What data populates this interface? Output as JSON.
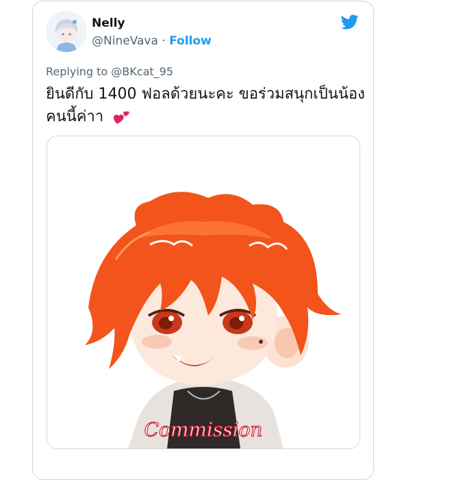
{
  "tweet": {
    "author_name": "Nelly",
    "author_handle": "@NineVava",
    "separator": " · ",
    "follow_label": "Follow",
    "replying_prefix": "Replying to ",
    "replying_to": "@BKcat_95",
    "text": "ยินดีกับ 1400 ฟอลด้วยนะคะ ขอร่วมสนุกเป็นน้องคนนี้ค่าา",
    "emoji": "two-hearts-icon",
    "media_watermark": "Commission"
  },
  "colors": {
    "accent": "#1d9bf0",
    "text": "#0f1419",
    "muted": "#536471",
    "border": "#cfd9de",
    "hair": "#f2541b",
    "heart": "#e0245e"
  },
  "icons": {
    "brand": "twitter-bird-icon",
    "avatar": "user-avatar"
  }
}
